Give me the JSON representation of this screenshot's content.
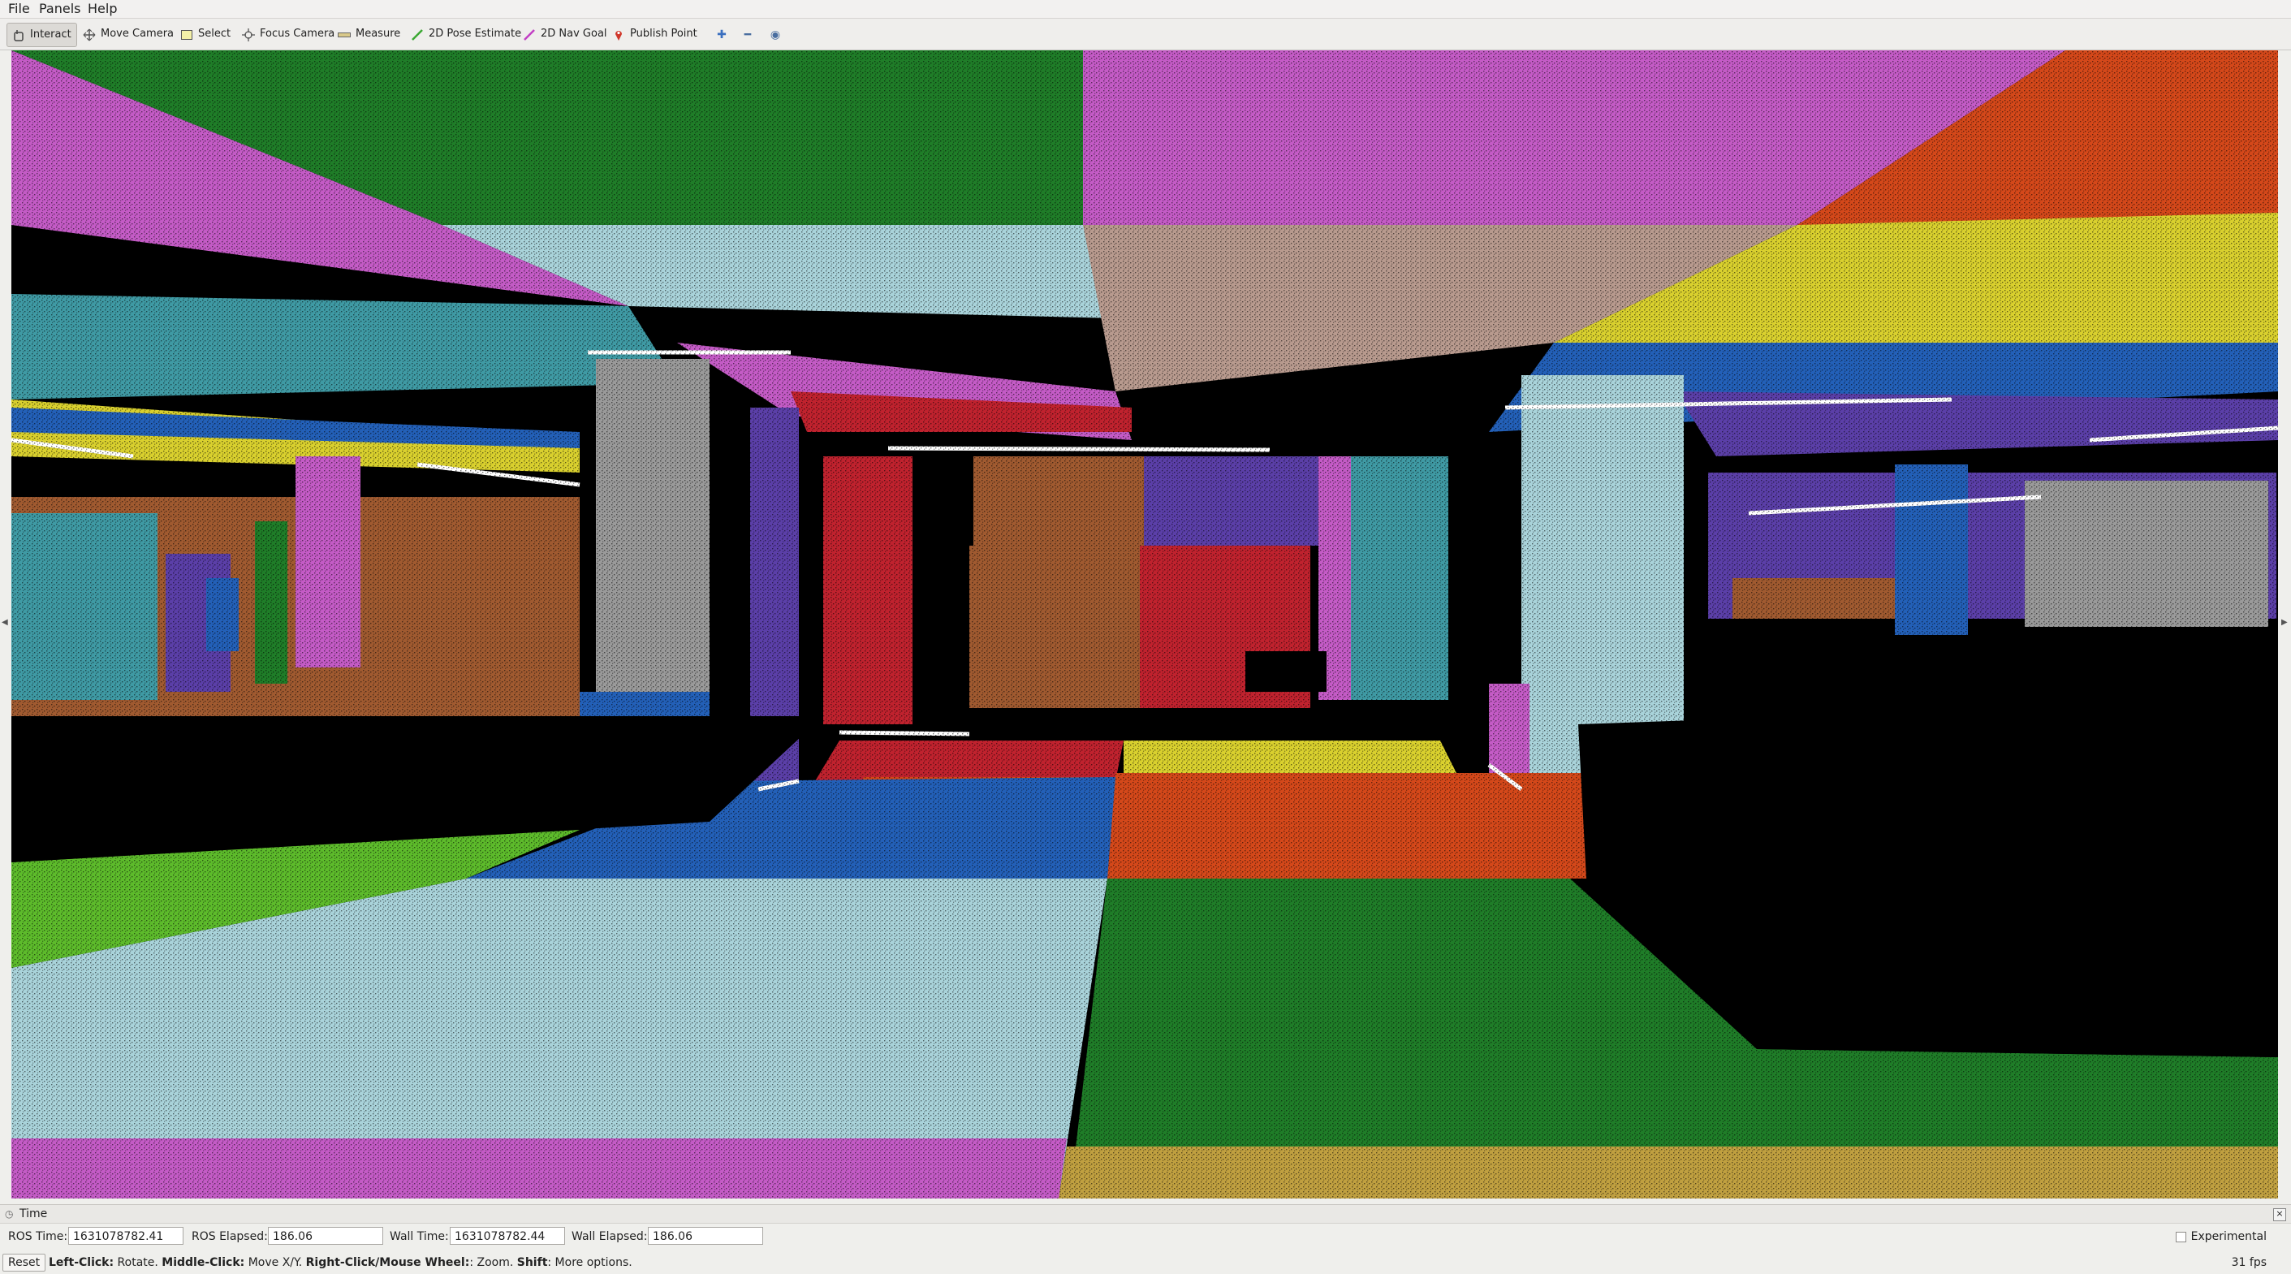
{
  "menu": {
    "file": "File",
    "panels": "Panels",
    "help": "Help"
  },
  "toolbar": {
    "interact": "Interact",
    "move_camera": "Move Camera",
    "select": "Select",
    "focus_camera": "Focus Camera",
    "measure": "Measure",
    "pose_estimate": "2D Pose Estimate",
    "nav_goal": "2D Nav Goal",
    "publish_point": "Publish Point"
  },
  "colors": {
    "green": "#1f7d28",
    "magenta": "#c45bc6",
    "lightblue": "#a9d3da",
    "teal": "#3f9aa4",
    "orange": "#d4481a",
    "yellow": "#d9d02e",
    "tan": "#b89a8e",
    "blue": "#2360b8",
    "purple": "#5b3fa8",
    "red": "#c0222e",
    "brown": "#a05a30",
    "gold": "#c0a040",
    "lime": "#5dbb2b",
    "gray": "#9a9a9a"
  },
  "time_panel": {
    "title": "Time",
    "ros_time_label": "ROS Time:",
    "ros_time_value": "1631078782.41",
    "ros_elapsed_label": "ROS Elapsed:",
    "ros_elapsed_value": "186.06",
    "wall_time_label": "Wall Time:",
    "wall_time_value": "1631078782.44",
    "wall_elapsed_label": "Wall Elapsed:",
    "wall_elapsed_value": "186.06",
    "experimental_label": "Experimental"
  },
  "status": {
    "reset_label": "Reset",
    "left_click_key": "Left-Click:",
    "left_click_action": " Rotate. ",
    "middle_click_key": "Middle-Click:",
    "middle_click_action": " Move X/Y. ",
    "right_click_key": "Right-Click/Mouse Wheel:",
    "right_click_action": ": Zoom. ",
    "shift_key": "Shift",
    "shift_action": ": More options.",
    "fps": "31 fps"
  }
}
